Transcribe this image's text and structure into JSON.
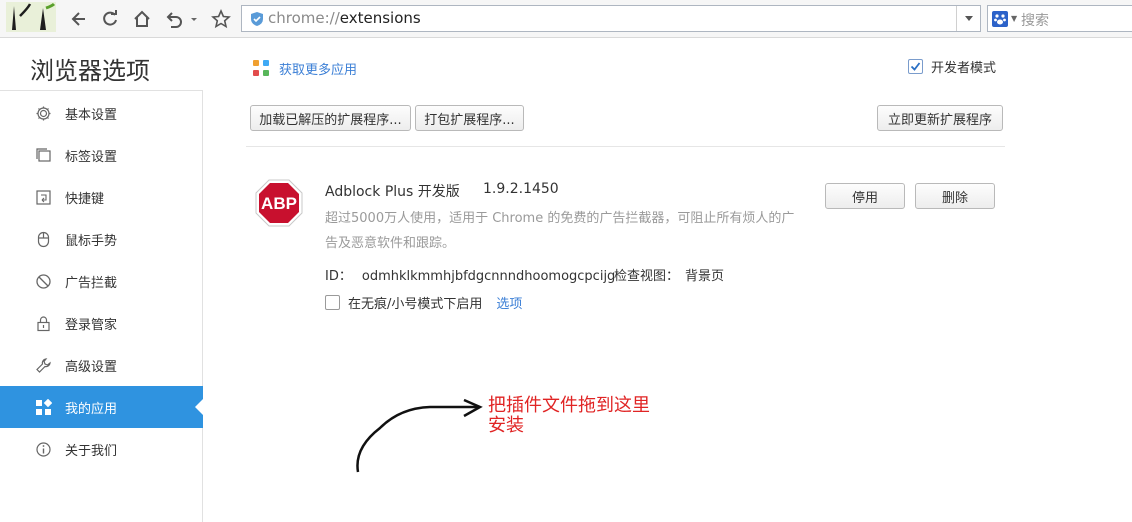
{
  "browser": {
    "url_scheme": "chrome://",
    "url_path": "extensions",
    "search_placeholder": "搜索"
  },
  "header": {
    "title": "浏览器选项",
    "more_apps_link": "获取更多应用",
    "developer_mode_label": "开发者模式",
    "developer_mode_checked": true
  },
  "sidebar": {
    "items": [
      {
        "label": "基本设置",
        "icon": "gear-icon"
      },
      {
        "label": "标签设置",
        "icon": "tabs-icon"
      },
      {
        "label": "快捷键",
        "icon": "keyboard-icon"
      },
      {
        "label": "鼠标手势",
        "icon": "mouse-icon"
      },
      {
        "label": "广告拦截",
        "icon": "block-icon"
      },
      {
        "label": "登录管家",
        "icon": "lock-icon"
      },
      {
        "label": "高级设置",
        "icon": "wrench-icon"
      },
      {
        "label": "我的应用",
        "icon": "apps-icon",
        "active": true
      },
      {
        "label": "关于我们",
        "icon": "info-icon"
      }
    ]
  },
  "actions": {
    "load_unpacked": "加载已解压的扩展程序...",
    "pack": "打包扩展程序...",
    "update_now": "立即更新扩展程序"
  },
  "extension": {
    "icon_text": "ABP",
    "name": "Adblock Plus 开发版",
    "version": "1.9.2.1450",
    "description": "超过5000万人使用，适用于 Chrome 的免费的广告拦截器，可阻止所有烦人的广告及恶意软件和跟踪。",
    "id_label": "ID：",
    "id_value": "odmhklkmmhjbfdgcnnndhoomogcpcijg",
    "inspect_label": "检查视图：",
    "inspect_value": "背景页",
    "incognito_label": "在无痕/小号模式下启用",
    "options_link": "选项",
    "disable_button": "停用",
    "remove_button": "删除"
  },
  "annotation": {
    "line1": "把插件文件拖到这里",
    "line2": "安装"
  },
  "colors": {
    "accent": "#2f93e0",
    "link": "#3b7fd6",
    "abp_red": "#c8102e",
    "annotation_red": "#e02424"
  }
}
